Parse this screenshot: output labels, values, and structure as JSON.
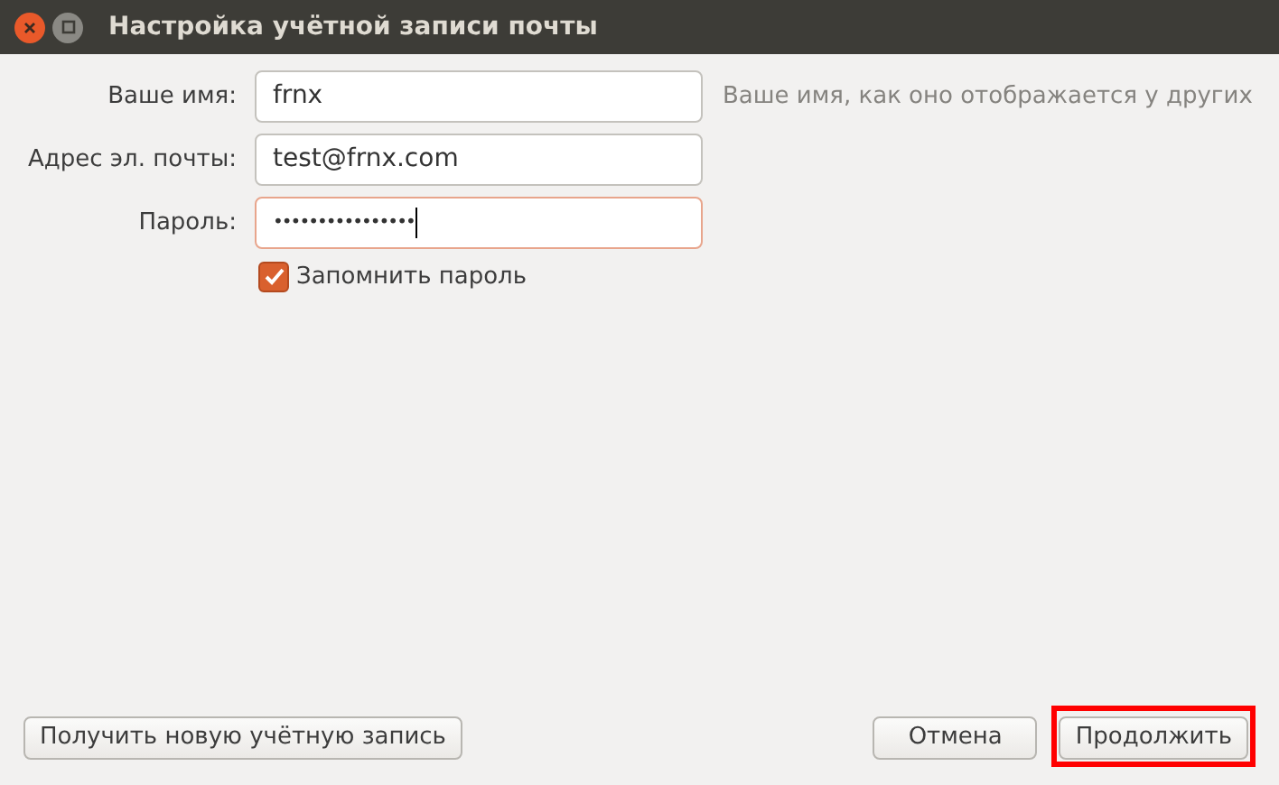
{
  "window": {
    "title": "Настройка учётной записи почты"
  },
  "fields": [
    {
      "label": "Ваше имя:",
      "value": "frnx",
      "hint": "Ваше имя, как оно отображается у других",
      "focused": false
    },
    {
      "label": "Адрес эл. почты:",
      "value": "test@frnx.com",
      "focused": false
    },
    {
      "label": "Пароль:",
      "value": "••••••••••••••••",
      "focused": true
    }
  ],
  "remember_password": {
    "label": "Запомнить пароль",
    "checked": true
  },
  "buttons": [
    {
      "label": "Получить новую учётную запись",
      "highlighted": false
    },
    {
      "label": "Отмена",
      "highlighted": false
    },
    {
      "label": "Продолжить",
      "highlighted": true
    }
  ]
}
